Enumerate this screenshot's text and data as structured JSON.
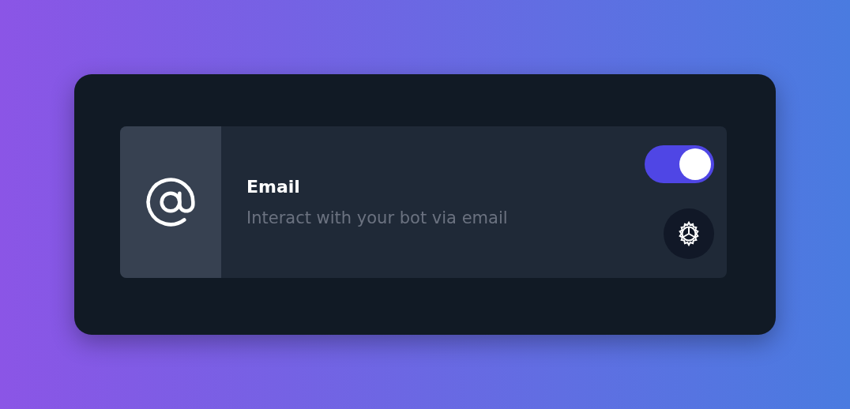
{
  "integration": {
    "title": "Email",
    "description": "Interact with your bot via email",
    "enabled": true
  }
}
